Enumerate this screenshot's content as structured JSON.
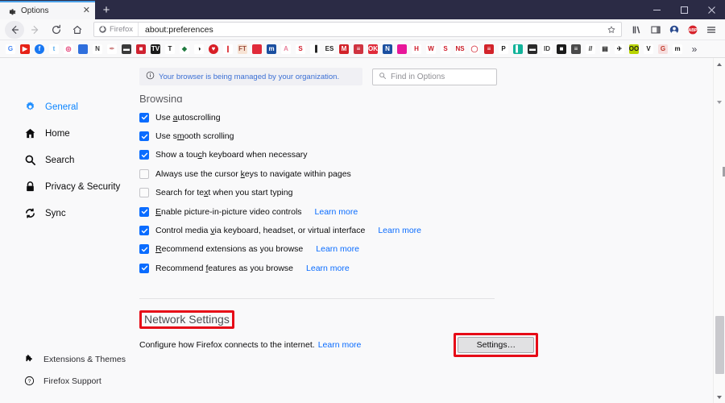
{
  "window": {
    "tab": {
      "title": "Options",
      "icon": "gear-icon",
      "close": "✕"
    },
    "newtab_label": "+",
    "controls": {
      "minimize": "minimize-icon",
      "maximize": "maximize-icon",
      "close": "close-icon"
    }
  },
  "toolbar": {
    "back": "back-arrow-icon",
    "forward": "forward-arrow-icon",
    "reload": "reload-icon",
    "home": "home-icon",
    "identity_label": "Firefox",
    "url": "about:preferences",
    "bookmark_star": "star-icon",
    "library": "library-icon",
    "sidebar_toggle": "sidebar-icon",
    "account": "account-icon",
    "adblock": "ABP",
    "menu": "hamburger-menu-icon"
  },
  "bookmarks": {
    "overflow": "»",
    "items": [
      {
        "name": "google",
        "glyph": "G",
        "bg": "#ffffff",
        "fg": "#4285f4",
        "shape": "square"
      },
      {
        "name": "youtube",
        "glyph": "▶",
        "bg": "#e62117",
        "fg": "#ffffff",
        "shape": "square"
      },
      {
        "name": "facebook",
        "glyph": "f",
        "bg": "#1877f2",
        "fg": "#ffffff",
        "shape": "circle"
      },
      {
        "name": "twitter",
        "glyph": "t",
        "bg": "#ffffff",
        "fg": "#55acee",
        "shape": "square"
      },
      {
        "name": "instagram",
        "glyph": "◎",
        "bg": "#ffffff",
        "fg": "#e1306c",
        "shape": "square"
      },
      {
        "name": "bookmark-blue",
        "glyph": "",
        "bg": "#2f6fdd",
        "fg": "#ffffff",
        "shape": "square"
      },
      {
        "name": "naver",
        "glyph": "N",
        "bg": "#ffffff",
        "fg": "#3b3b3b",
        "shape": "square"
      },
      {
        "name": "feather",
        "glyph": "✒",
        "bg": "#ffffff",
        "fg": "#d08a8a",
        "shape": "square"
      },
      {
        "name": "card-grey",
        "glyph": "▬",
        "bg": "#3a3a3a",
        "fg": "#ffffff",
        "shape": "square"
      },
      {
        "name": "toolbox",
        "glyph": "■",
        "bg": "#cf2230",
        "fg": "#ffffff",
        "shape": "square"
      },
      {
        "name": "tv",
        "glyph": "TV",
        "bg": "#1a1a1a",
        "fg": "#ffffff",
        "shape": "square"
      },
      {
        "name": "letter-t",
        "glyph": "T",
        "bg": "#ffffff",
        "fg": "#1a1a1a",
        "shape": "square"
      },
      {
        "name": "diamond",
        "glyph": "◆",
        "bg": "#ffffff",
        "fg": "#1f7a3f",
        "shape": "square"
      },
      {
        "name": "contrast",
        "glyph": "◑",
        "bg": "#ffffff",
        "fg": "#1a1a1a",
        "shape": "square"
      },
      {
        "name": "shield-red",
        "glyph": "♥",
        "bg": "#d81f26",
        "fg": "#ffffff",
        "shape": "circle"
      },
      {
        "name": "bar-red",
        "glyph": "❙",
        "bg": "#ffffff",
        "fg": "#d81f26",
        "shape": "square"
      },
      {
        "name": "ft",
        "glyph": "FT",
        "bg": "#f7e3d4",
        "fg": "#9a4b3c",
        "shape": "square"
      },
      {
        "name": "red-square",
        "glyph": "",
        "bg": "#e02b3a",
        "fg": "#ffffff",
        "shape": "square"
      },
      {
        "name": "m-blue",
        "glyph": "m",
        "bg": "#1b4fa0",
        "fg": "#ffffff",
        "shape": "square"
      },
      {
        "name": "pink-a",
        "glyph": "A",
        "bg": "#ffffff",
        "fg": "#e87f9a",
        "shape": "square"
      },
      {
        "name": "s-red",
        "glyph": "S",
        "bg": "#ffffff",
        "fg": "#d01b2a",
        "shape": "square"
      },
      {
        "name": "chart",
        "glyph": "▐",
        "bg": "#ffffff",
        "fg": "#1a1a1a",
        "shape": "square"
      },
      {
        "name": "es",
        "glyph": "ES",
        "bg": "#ffffff",
        "fg": "#1a1a1a",
        "shape": "square"
      },
      {
        "name": "m-red",
        "glyph": "M",
        "bg": "#d2232a",
        "fg": "#ffffff",
        "shape": "square"
      },
      {
        "name": "blue-lines",
        "glyph": "≡",
        "bg": "#cf3340",
        "fg": "#ffffff",
        "shape": "square"
      },
      {
        "name": "ok",
        "glyph": "OK",
        "bg": "#e02b3a",
        "fg": "#ffffff",
        "shape": "square"
      },
      {
        "name": "n-blue",
        "glyph": "N",
        "bg": "#1b4fa0",
        "fg": "#ffffff",
        "shape": "square"
      },
      {
        "name": "magenta",
        "glyph": "",
        "bg": "#e8179a",
        "fg": "#ffffff",
        "shape": "square"
      },
      {
        "name": "hh",
        "glyph": "H",
        "bg": "#ffffff",
        "fg": "#d01b2a",
        "shape": "square"
      },
      {
        "name": "w-red",
        "glyph": "W",
        "bg": "#ffffff",
        "fg": "#c81a25",
        "shape": "square"
      },
      {
        "name": "s-plain",
        "glyph": "S",
        "bg": "#ffffff",
        "fg": "#d01b2a",
        "shape": "square"
      },
      {
        "name": "ns",
        "glyph": "NS",
        "bg": "#ffffff",
        "fg": "#c81a25",
        "shape": "square"
      },
      {
        "name": "chat",
        "glyph": "◯",
        "bg": "#ffffff",
        "fg": "#d8434f",
        "shape": "square"
      },
      {
        "name": "stripes",
        "glyph": "≡",
        "bg": "#d2232a",
        "fg": "#ffffff",
        "shape": "square"
      },
      {
        "name": "p-serif",
        "glyph": "P",
        "bg": "#ffffff",
        "fg": "#1a1a1a",
        "shape": "square"
      },
      {
        "name": "teal-bars",
        "glyph": "▌",
        "bg": "#12b39a",
        "fg": "#ffffff",
        "shape": "square"
      },
      {
        "name": "dark-card",
        "glyph": "▬",
        "bg": "#2b2b2b",
        "fg": "#ffffff",
        "shape": "square"
      },
      {
        "name": "i-d",
        "glyph": "ID",
        "bg": "#ffffff",
        "fg": "#3a3a3a",
        "shape": "square"
      },
      {
        "name": "camera",
        "glyph": "■",
        "bg": "#1a1a1a",
        "fg": "#ffffff",
        "shape": "square"
      },
      {
        "name": "news-grey",
        "glyph": "≡",
        "bg": "#4a4a4a",
        "fg": "#ffffff",
        "shape": "square"
      },
      {
        "name": "slash",
        "glyph": "//",
        "bg": "#ffffff",
        "fg": "#1a1a1a",
        "shape": "square"
      },
      {
        "name": "paper",
        "glyph": "▤",
        "bg": "#ffffff",
        "fg": "#1a1a1a",
        "shape": "square"
      },
      {
        "name": "bird",
        "glyph": "✈",
        "bg": "#ffffff",
        "fg": "#1a1a1a",
        "shape": "square"
      },
      {
        "name": "goggles",
        "glyph": "OO",
        "bg": "#b8d400",
        "fg": "#1a1a1a",
        "shape": "square"
      },
      {
        "name": "v-mark",
        "glyph": "V",
        "bg": "#ffffff",
        "fg": "#1a1a1a",
        "shape": "square"
      },
      {
        "name": "g-pink",
        "glyph": "G",
        "bg": "#f6dede",
        "fg": "#c0392b",
        "shape": "square"
      },
      {
        "name": "m-black",
        "glyph": "m",
        "bg": "#ffffff",
        "fg": "#1a1a1a",
        "shape": "square"
      }
    ]
  },
  "sidebar": {
    "items": [
      {
        "label": "General",
        "icon": "gear-icon",
        "selected": true
      },
      {
        "label": "Home",
        "icon": "home-icon",
        "selected": false
      },
      {
        "label": "Search",
        "icon": "search-icon",
        "selected": false
      },
      {
        "label": "Privacy & Security",
        "icon": "lock-icon",
        "selected": false
      },
      {
        "label": "Sync",
        "icon": "sync-icon",
        "selected": false
      }
    ],
    "footer": [
      {
        "label": "Extensions & Themes",
        "icon": "puzzle-icon"
      },
      {
        "label": "Firefox Support",
        "icon": "question-icon"
      }
    ]
  },
  "notice": {
    "icon": "info-icon",
    "text": "Your browser is being managed by your organization."
  },
  "search": {
    "icon": "search-icon",
    "placeholder": "Find in Options"
  },
  "browsing": {
    "heading": "Browsing",
    "options": [
      {
        "label_pre": "Use ",
        "key": "a",
        "label_post": "utoscrolling",
        "checked": true,
        "learn_more": ""
      },
      {
        "label_pre": "Use s",
        "key": "m",
        "label_post": "ooth scrolling",
        "checked": true,
        "learn_more": ""
      },
      {
        "label_pre": "Show a tou",
        "key": "c",
        "label_post": "h keyboard when necessary",
        "checked": true,
        "learn_more": ""
      },
      {
        "label_pre": "Always use the cursor ",
        "key": "k",
        "label_post": "eys to navigate within pages",
        "checked": false,
        "learn_more": ""
      },
      {
        "label_pre": "Search for te",
        "key": "x",
        "label_post": "t when you start typing",
        "checked": false,
        "learn_more": ""
      },
      {
        "label_pre": "",
        "key": "E",
        "label_post": "nable picture-in-picture video controls",
        "checked": true,
        "learn_more": "Learn more"
      },
      {
        "label_pre": "Control media ",
        "key": "v",
        "label_post": "ia keyboard, headset, or virtual interface",
        "checked": true,
        "learn_more": "Learn more"
      },
      {
        "label_pre": "",
        "key": "R",
        "label_post": "ecommend extensions as you browse",
        "checked": true,
        "learn_more": "Learn more"
      },
      {
        "label_pre": "Recommend ",
        "key": "f",
        "label_post": "eatures as you browse",
        "checked": true,
        "learn_more": "Learn more"
      }
    ]
  },
  "network": {
    "heading": "Network Settings",
    "description": "Configure how Firefox connects to the internet.",
    "learn_more": "Learn more",
    "button": "Settings…",
    "highlight_color": "#e60a17"
  }
}
